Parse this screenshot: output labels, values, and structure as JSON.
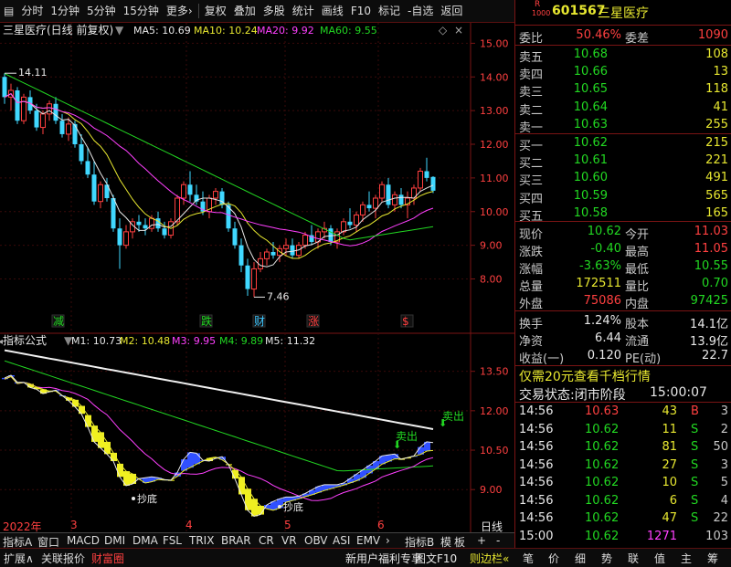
{
  "toolbar": {
    "left": [
      "分时",
      "1分钟",
      "5分钟",
      "15分钟",
      "更多›"
    ],
    "mid": [
      "复权",
      "叠加",
      "多股",
      "统计",
      "画线",
      "F10",
      "标记",
      "-自选",
      "返回"
    ]
  },
  "chart": {
    "title": "三星医疗(日线 前复权)",
    "ma": [
      {
        "label": "MA5: 10.69",
        "color": "#e8e8e8"
      },
      {
        "label": "MA10: 10.24",
        "color": "#e8e830"
      },
      {
        "label": "MA20: 9.92",
        "color": "#ff40ff"
      },
      {
        "label": "MA60: 9.55",
        "color": "#22d822"
      }
    ],
    "price_ticks": [
      "15.00",
      "14.00",
      "13.00",
      "12.00",
      "11.00",
      "10.00",
      "9.00",
      "8.00"
    ],
    "high_label": "14.11",
    "low_label": "7.46",
    "markers": [
      {
        "t": "减",
        "color": "#22d822"
      },
      {
        "t": "跌",
        "color": "#22d822"
      },
      {
        "t": "财",
        "color": "#40c8ff"
      },
      {
        "t": "涨",
        "color": "#ff4040"
      },
      {
        "t": "$",
        "color": "#ff4040"
      }
    ],
    "candles": [
      [
        14.0,
        14.11,
        13.2,
        13.4
      ],
      [
        13.4,
        13.8,
        13.0,
        13.6
      ],
      [
        13.6,
        13.7,
        12.6,
        12.7
      ],
      [
        12.7,
        13.5,
        12.6,
        13.4
      ],
      [
        13.4,
        13.6,
        12.9,
        13.0
      ],
      [
        13.0,
        13.2,
        12.4,
        12.5
      ],
      [
        12.5,
        13.0,
        12.3,
        12.9
      ],
      [
        12.9,
        13.3,
        12.7,
        13.2
      ],
      [
        13.2,
        13.4,
        12.6,
        12.7
      ],
      [
        12.7,
        12.9,
        12.2,
        12.3
      ],
      [
        12.3,
        12.8,
        12.1,
        12.6
      ],
      [
        12.6,
        12.7,
        11.9,
        12.0
      ],
      [
        12.0,
        12.3,
        11.4,
        11.5
      ],
      [
        11.5,
        11.9,
        11.0,
        11.1
      ],
      [
        11.1,
        11.5,
        10.2,
        10.3
      ],
      [
        10.3,
        10.9,
        10.1,
        10.8
      ],
      [
        10.8,
        11.0,
        10.3,
        10.4
      ],
      [
        10.4,
        10.5,
        9.4,
        9.5
      ],
      [
        9.5,
        9.8,
        8.3,
        9.0
      ],
      [
        9.0,
        9.6,
        8.9,
        9.4
      ],
      [
        9.4,
        9.8,
        9.2,
        9.7
      ],
      [
        9.7,
        9.9,
        9.4,
        9.6
      ],
      [
        9.6,
        9.8,
        9.3,
        9.5
      ],
      [
        9.5,
        9.9,
        9.4,
        9.8
      ],
      [
        9.8,
        10.0,
        9.4,
        9.5
      ],
      [
        9.5,
        9.7,
        9.2,
        9.3
      ],
      [
        9.3,
        9.8,
        9.2,
        9.7
      ],
      [
        9.7,
        10.5,
        9.6,
        10.4
      ],
      [
        10.4,
        10.9,
        10.2,
        10.8
      ],
      [
        10.8,
        11.2,
        10.3,
        10.5
      ],
      [
        10.5,
        10.8,
        10.2,
        10.3
      ],
      [
        10.3,
        10.6,
        9.9,
        10.0
      ],
      [
        10.0,
        10.5,
        9.8,
        10.4
      ],
      [
        10.4,
        10.7,
        10.2,
        10.6
      ],
      [
        10.6,
        10.7,
        10.1,
        10.2
      ],
      [
        10.2,
        10.3,
        9.4,
        9.5
      ],
      [
        9.5,
        9.7,
        8.9,
        9.0
      ],
      [
        9.0,
        9.2,
        8.2,
        8.4
      ],
      [
        8.4,
        8.6,
        7.5,
        7.7
      ],
      [
        7.7,
        8.5,
        7.46,
        8.3
      ],
      [
        8.3,
        8.8,
        8.2,
        8.6
      ],
      [
        8.6,
        8.9,
        8.4,
        8.8
      ],
      [
        8.8,
        9.1,
        8.6,
        8.7
      ],
      [
        8.7,
        9.0,
        8.5,
        8.9
      ],
      [
        8.9,
        9.2,
        8.7,
        9.0
      ],
      [
        9.0,
        9.2,
        8.6,
        8.7
      ],
      [
        8.7,
        9.1,
        8.6,
        9.0
      ],
      [
        9.0,
        9.4,
        8.9,
        9.3
      ],
      [
        9.3,
        9.6,
        9.0,
        9.1
      ],
      [
        9.1,
        9.5,
        8.9,
        9.4
      ],
      [
        9.4,
        9.7,
        9.2,
        9.5
      ],
      [
        9.5,
        9.6,
        9.0,
        9.1
      ],
      [
        9.1,
        9.5,
        8.9,
        9.4
      ],
      [
        9.4,
        9.8,
        9.3,
        9.7
      ],
      [
        9.7,
        10.1,
        9.5,
        9.6
      ],
      [
        9.6,
        10.0,
        9.4,
        9.9
      ],
      [
        9.9,
        10.3,
        9.7,
        10.2
      ],
      [
        10.2,
        10.6,
        10.0,
        10.1
      ],
      [
        10.1,
        10.5,
        9.8,
        10.4
      ],
      [
        10.4,
        10.9,
        10.3,
        10.8
      ],
      [
        10.8,
        11.0,
        10.1,
        10.2
      ],
      [
        10.2,
        10.6,
        10.0,
        10.5
      ],
      [
        10.5,
        10.7,
        10.1,
        10.2
      ],
      [
        10.2,
        10.6,
        9.8,
        10.4
      ],
      [
        10.4,
        10.8,
        10.2,
        10.7
      ],
      [
        10.7,
        11.3,
        10.6,
        11.2
      ],
      [
        11.2,
        11.6,
        10.9,
        11.0
      ],
      [
        11.03,
        11.05,
        10.55,
        10.62
      ]
    ],
    "indicator_title": "指标公式",
    "ind_lines": [
      {
        "label": "M1: 10.73",
        "color": "#e8e8e8"
      },
      {
        "label": "M2: 10.48",
        "color": "#e8e830"
      },
      {
        "label": "M3: 9.95",
        "color": "#ff40ff"
      },
      {
        "label": "M4: 9.89",
        "color": "#22d822"
      },
      {
        "label": "M5: 11.32",
        "color": "#e8e8e8"
      }
    ],
    "ind_ticks": [
      "13.50",
      "12.00",
      "10.50",
      "9.00"
    ],
    "ind_notes": {
      "chaodi1": "抄底",
      "chaodi2": "抄底",
      "maichu1": "卖出",
      "maichu2": "卖出"
    },
    "x_labels": [
      "2022年",
      "3",
      "4",
      "5",
      "6"
    ],
    "period_label": "日线"
  },
  "tabs": [
    "指标A",
    "窗口",
    "MACD",
    "DMI",
    "DMA",
    "FSL",
    "TRIX",
    "BRAR",
    "CR",
    "VR",
    "OBV",
    "ASI",
    "EMV",
    "›",
    "指标B",
    "模",
    "板",
    "+",
    "-"
  ],
  "bottom": {
    "left": [
      "扩展∧",
      "关联报价",
      "财富圈"
    ],
    "promo": "新用户福利专享",
    "right": [
      "图文F10",
      "则边栏«"
    ],
    "nav": [
      "笔",
      "价",
      "细",
      "势",
      "联",
      "值",
      "主",
      "筹"
    ]
  },
  "quote": {
    "badge": "R",
    "code": "601567",
    "name": "三星医疗",
    "wei_bi_label": "委比",
    "wei_bi": "50.46%",
    "wei_cha_label": "委差",
    "wei_cha": "1090",
    "asks": [
      {
        "label": "卖五",
        "price": "10.68",
        "vol": "108"
      },
      {
        "label": "卖四",
        "price": "10.66",
        "vol": "13"
      },
      {
        "label": "卖三",
        "price": "10.65",
        "vol": "118"
      },
      {
        "label": "卖二",
        "price": "10.64",
        "vol": "41"
      },
      {
        "label": "卖一",
        "price": "10.63",
        "vol": "255"
      }
    ],
    "bids": [
      {
        "label": "买一",
        "price": "10.62",
        "vol": "215"
      },
      {
        "label": "买二",
        "price": "10.61",
        "vol": "221"
      },
      {
        "label": "买三",
        "price": "10.60",
        "vol": "491"
      },
      {
        "label": "买四",
        "price": "10.59",
        "vol": "565"
      },
      {
        "label": "买五",
        "price": "10.58",
        "vol": "165"
      }
    ],
    "stats": [
      {
        "k1": "现价",
        "v1": "10.62",
        "c1": "grn",
        "k2": "今开",
        "v2": "11.03",
        "c2": "red"
      },
      {
        "k1": "涨跌",
        "v1": "-0.40",
        "c1": "grn",
        "k2": "最高",
        "v2": "11.05",
        "c2": "red"
      },
      {
        "k1": "涨幅",
        "v1": "-3.63%",
        "c1": "grn",
        "k2": "最低",
        "v2": "10.55",
        "c2": "grn"
      },
      {
        "k1": "总量",
        "v1": "172511",
        "c1": "yel",
        "k2": "量比",
        "v2": "0.70",
        "c2": "grn"
      },
      {
        "k1": "外盘",
        "v1": "75086",
        "c1": "red",
        "k2": "内盘",
        "v2": "97425",
        "c2": "grn"
      }
    ],
    "stats2": [
      {
        "k1": "换手",
        "v1": "1.24%",
        "k2": "股本",
        "v2": "14.1亿"
      },
      {
        "k1": "净资",
        "v1": "6.44",
        "k2": "流通",
        "v2": "13.9亿"
      },
      {
        "k1": "收益(一)",
        "v1": "0.120",
        "k2": "PE(动)",
        "v2": "22.7"
      }
    ],
    "promo": "仅需20元查看千档行情",
    "trade_state_label": "交易状态:",
    "trade_state": "闭市阶段",
    "trade_time": "15:00:07",
    "ticks": [
      {
        "t": "14:56",
        "p": "10.63",
        "pc": "red",
        "v": "43",
        "s": "B",
        "sc": "red",
        "n": "3"
      },
      {
        "t": "14:56",
        "p": "10.62",
        "pc": "grn",
        "v": "11",
        "s": "S",
        "sc": "grn",
        "n": "2"
      },
      {
        "t": "14:56",
        "p": "10.62",
        "pc": "grn",
        "v": "81",
        "s": "S",
        "sc": "grn",
        "n": "50"
      },
      {
        "t": "14:56",
        "p": "10.62",
        "pc": "grn",
        "v": "27",
        "s": "S",
        "sc": "grn",
        "n": "3"
      },
      {
        "t": "14:56",
        "p": "10.62",
        "pc": "grn",
        "v": "10",
        "s": "S",
        "sc": "grn",
        "n": "5"
      },
      {
        "t": "14:56",
        "p": "10.62",
        "pc": "grn",
        "v": "6",
        "s": "S",
        "sc": "grn",
        "n": "4"
      },
      {
        "t": "14:56",
        "p": "10.62",
        "pc": "grn",
        "v": "47",
        "s": "S",
        "sc": "grn",
        "n": "22"
      },
      {
        "t": "15:00",
        "p": "10.62",
        "pc": "grn",
        "v": "1271",
        "vc": "mag",
        "s": "",
        "sc": "",
        "n": "103"
      }
    ]
  }
}
